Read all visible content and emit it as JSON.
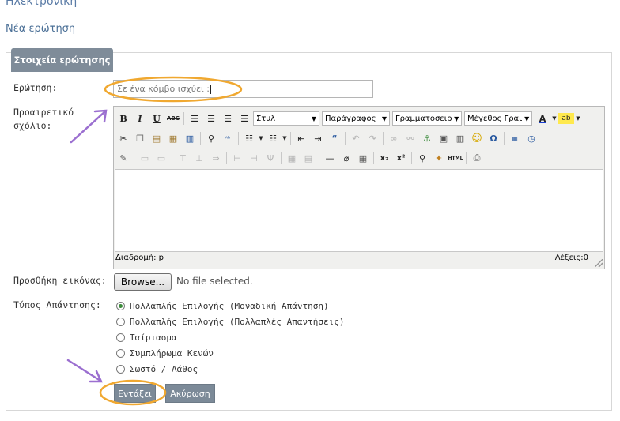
{
  "page": {
    "title": "Ηλεκτρονική",
    "breadcrumb": "Νέα ερώτηση"
  },
  "panel": {
    "legend": "Στοιχεία ερώτησης"
  },
  "form": {
    "question_label": "Ερώτηση:",
    "question_value": "Σε ένα κόμβο ισχύει :",
    "comment_label_1": "Προαιρετικό",
    "comment_label_2": "σχόλιο:",
    "image_label": "Προσθήκη εικόνας:",
    "browse_label": "Browse...",
    "no_file": "No file selected.",
    "answer_type_label": "Τύπος Απάντησης:"
  },
  "editor": {
    "style_select": "Στυλ",
    "paragraph_select": "Παράγραφος",
    "font_select": "Γραμματοσειρά",
    "size_select": "Μέγεθος Γραμμ",
    "status_path": "Διαδρομή: p",
    "status_words": "Λέξεις:0"
  },
  "answer_types": [
    {
      "label": "Πολλαπλής Επιλογής (Μοναδική Απάντηση)",
      "selected": true
    },
    {
      "label": "Πολλαπλής Επιλογής (Πολλαπλές Απαντήσεις)",
      "selected": false
    },
    {
      "label": "Ταίριασμα",
      "selected": false
    },
    {
      "label": "Συμπλήρωμα Κενών",
      "selected": false
    },
    {
      "label": "Σωστό / Λάθος",
      "selected": false
    }
  ],
  "buttons": {
    "insert": "Εντάξει",
    "cancel": "Ακύρωση"
  },
  "colors": {
    "annotation_orange": "#f0a830",
    "annotation_arrow": "#9b6fd0",
    "button_bg": "#7c8a98"
  }
}
